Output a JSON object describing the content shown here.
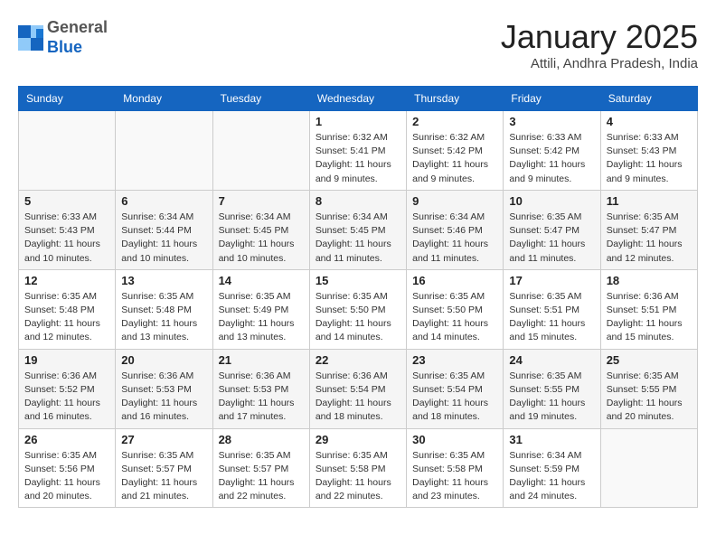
{
  "header": {
    "logo_line1": "General",
    "logo_line2": "Blue",
    "month_title": "January 2025",
    "subtitle": "Attili, Andhra Pradesh, India"
  },
  "weekdays": [
    "Sunday",
    "Monday",
    "Tuesday",
    "Wednesday",
    "Thursday",
    "Friday",
    "Saturday"
  ],
  "weeks": [
    [
      {
        "day": "",
        "info": ""
      },
      {
        "day": "",
        "info": ""
      },
      {
        "day": "",
        "info": ""
      },
      {
        "day": "1",
        "info": "Sunrise: 6:32 AM\nSunset: 5:41 PM\nDaylight: 11 hours\nand 9 minutes."
      },
      {
        "day": "2",
        "info": "Sunrise: 6:32 AM\nSunset: 5:42 PM\nDaylight: 11 hours\nand 9 minutes."
      },
      {
        "day": "3",
        "info": "Sunrise: 6:33 AM\nSunset: 5:42 PM\nDaylight: 11 hours\nand 9 minutes."
      },
      {
        "day": "4",
        "info": "Sunrise: 6:33 AM\nSunset: 5:43 PM\nDaylight: 11 hours\nand 9 minutes."
      }
    ],
    [
      {
        "day": "5",
        "info": "Sunrise: 6:33 AM\nSunset: 5:43 PM\nDaylight: 11 hours\nand 10 minutes."
      },
      {
        "day": "6",
        "info": "Sunrise: 6:34 AM\nSunset: 5:44 PM\nDaylight: 11 hours\nand 10 minutes."
      },
      {
        "day": "7",
        "info": "Sunrise: 6:34 AM\nSunset: 5:45 PM\nDaylight: 11 hours\nand 10 minutes."
      },
      {
        "day": "8",
        "info": "Sunrise: 6:34 AM\nSunset: 5:45 PM\nDaylight: 11 hours\nand 11 minutes."
      },
      {
        "day": "9",
        "info": "Sunrise: 6:34 AM\nSunset: 5:46 PM\nDaylight: 11 hours\nand 11 minutes."
      },
      {
        "day": "10",
        "info": "Sunrise: 6:35 AM\nSunset: 5:47 PM\nDaylight: 11 hours\nand 11 minutes."
      },
      {
        "day": "11",
        "info": "Sunrise: 6:35 AM\nSunset: 5:47 PM\nDaylight: 11 hours\nand 12 minutes."
      }
    ],
    [
      {
        "day": "12",
        "info": "Sunrise: 6:35 AM\nSunset: 5:48 PM\nDaylight: 11 hours\nand 12 minutes."
      },
      {
        "day": "13",
        "info": "Sunrise: 6:35 AM\nSunset: 5:48 PM\nDaylight: 11 hours\nand 13 minutes."
      },
      {
        "day": "14",
        "info": "Sunrise: 6:35 AM\nSunset: 5:49 PM\nDaylight: 11 hours\nand 13 minutes."
      },
      {
        "day": "15",
        "info": "Sunrise: 6:35 AM\nSunset: 5:50 PM\nDaylight: 11 hours\nand 14 minutes."
      },
      {
        "day": "16",
        "info": "Sunrise: 6:35 AM\nSunset: 5:50 PM\nDaylight: 11 hours\nand 14 minutes."
      },
      {
        "day": "17",
        "info": "Sunrise: 6:35 AM\nSunset: 5:51 PM\nDaylight: 11 hours\nand 15 minutes."
      },
      {
        "day": "18",
        "info": "Sunrise: 6:36 AM\nSunset: 5:51 PM\nDaylight: 11 hours\nand 15 minutes."
      }
    ],
    [
      {
        "day": "19",
        "info": "Sunrise: 6:36 AM\nSunset: 5:52 PM\nDaylight: 11 hours\nand 16 minutes."
      },
      {
        "day": "20",
        "info": "Sunrise: 6:36 AM\nSunset: 5:53 PM\nDaylight: 11 hours\nand 16 minutes."
      },
      {
        "day": "21",
        "info": "Sunrise: 6:36 AM\nSunset: 5:53 PM\nDaylight: 11 hours\nand 17 minutes."
      },
      {
        "day": "22",
        "info": "Sunrise: 6:36 AM\nSunset: 5:54 PM\nDaylight: 11 hours\nand 18 minutes."
      },
      {
        "day": "23",
        "info": "Sunrise: 6:35 AM\nSunset: 5:54 PM\nDaylight: 11 hours\nand 18 minutes."
      },
      {
        "day": "24",
        "info": "Sunrise: 6:35 AM\nSunset: 5:55 PM\nDaylight: 11 hours\nand 19 minutes."
      },
      {
        "day": "25",
        "info": "Sunrise: 6:35 AM\nSunset: 5:55 PM\nDaylight: 11 hours\nand 20 minutes."
      }
    ],
    [
      {
        "day": "26",
        "info": "Sunrise: 6:35 AM\nSunset: 5:56 PM\nDaylight: 11 hours\nand 20 minutes."
      },
      {
        "day": "27",
        "info": "Sunrise: 6:35 AM\nSunset: 5:57 PM\nDaylight: 11 hours\nand 21 minutes."
      },
      {
        "day": "28",
        "info": "Sunrise: 6:35 AM\nSunset: 5:57 PM\nDaylight: 11 hours\nand 22 minutes."
      },
      {
        "day": "29",
        "info": "Sunrise: 6:35 AM\nSunset: 5:58 PM\nDaylight: 11 hours\nand 22 minutes."
      },
      {
        "day": "30",
        "info": "Sunrise: 6:35 AM\nSunset: 5:58 PM\nDaylight: 11 hours\nand 23 minutes."
      },
      {
        "day": "31",
        "info": "Sunrise: 6:34 AM\nSunset: 5:59 PM\nDaylight: 11 hours\nand 24 minutes."
      },
      {
        "day": "",
        "info": ""
      }
    ]
  ]
}
